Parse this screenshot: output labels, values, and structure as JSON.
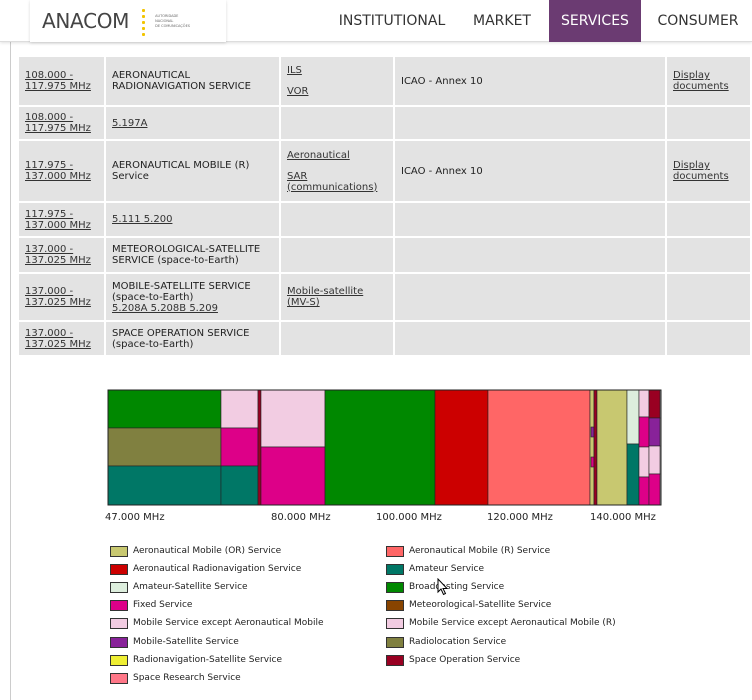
{
  "header": {
    "logo_text": "ANACOM",
    "logo_subtitle": [
      "AUTORIDADE",
      "NACIONAL",
      "DE COMUNICAÇÕES"
    ],
    "nav": [
      {
        "label": "INSTITUTIONAL",
        "active": false
      },
      {
        "label": "MARKET",
        "active": false
      },
      {
        "label": "SERVICES",
        "active": true
      },
      {
        "label": "CONSUMER",
        "active": false
      }
    ]
  },
  "table": {
    "rows": [
      {
        "band": "108.000 - 117.975 MHz",
        "service": "AERONAUTICAL RADIONAVIGATION SERVICE",
        "service_link": false,
        "applications": [
          "ILS",
          "VOR"
        ],
        "standard": "ICAO - Annex 10",
        "documents": "Display documents"
      },
      {
        "band": "108.000 - 117.975 MHz",
        "service": "5.197A",
        "service_link": true,
        "applications": [],
        "standard": "",
        "documents": ""
      },
      {
        "band": "117.975 - 137.000 MHz",
        "service": "AERONAUTICAL MOBILE (R) Service",
        "service_link": false,
        "applications": [
          "Aeronautical",
          "SAR (communications)"
        ],
        "standard": "ICAO - Annex 10",
        "documents": "Display documents"
      },
      {
        "band": "117.975 - 137.000 MHz",
        "service": "5.111 5.200",
        "service_link": true,
        "applications": [],
        "standard": "",
        "documents": ""
      },
      {
        "band": "137.000 - 137.025 MHz",
        "service": "METEOROLOGICAL-SATELLITE SERVICE (space-to-Earth)",
        "service_link": false,
        "applications": [],
        "standard": "",
        "documents": ""
      },
      {
        "band": "137.000 - 137.025 MHz",
        "service": "MOBILE-SATELLITE SERVICE (space-to-Earth)",
        "service_link": false,
        "service_footnote": "5.208A 5.208B 5.209",
        "applications": [
          "Mobile-satellite (MV-S)"
        ],
        "standard": "",
        "documents": ""
      },
      {
        "band": "137.000 - 137.025 MHz",
        "service": "SPACE OPERATION SERVICE (space-to-Earth)",
        "service_link": false,
        "applications": [],
        "standard": "",
        "documents": ""
      }
    ]
  },
  "colors": {
    "aero_mobile_or": "#c8c870",
    "aero_mobile_r": "#ff6666",
    "aero_radionav": "#cc0000",
    "amateur": "#007766",
    "amateur_sat": "#ddeedd",
    "broadcasting": "#008800",
    "fixed": "#dd0088",
    "meteo_sat": "#884400",
    "mobile_except_aero": "#f2cce2",
    "mobile_except_aero_r": "#f2cce2",
    "mobile_sat": "#882299",
    "radiolocation": "#808040",
    "radionav_sat": "#eeee33",
    "space_op": "#990022",
    "space_research": "#ff7788",
    "nav_active_bg": "#6b3b72"
  },
  "chart_data": {
    "type": "band-allocation",
    "x_ticks": [
      "47.000 MHz",
      "80.000 MHz",
      "100.000 MHz",
      "120.000 MHz",
      "140.000 MHz"
    ],
    "legend": [
      {
        "label": "Aeronautical Mobile (OR) Service",
        "color_key": "aero_mobile_or"
      },
      {
        "label": "Aeronautical Mobile (R) Service",
        "color_key": "aero_mobile_r"
      },
      {
        "label": "Aeronautical Radionavigation Service",
        "color_key": "aero_radionav"
      },
      {
        "label": "Amateur Service",
        "color_key": "amateur"
      },
      {
        "label": "Amateur-Satellite Service",
        "color_key": "amateur_sat"
      },
      {
        "label": "Broadcasting Service",
        "color_key": "broadcasting"
      },
      {
        "label": "Fixed Service",
        "color_key": "fixed"
      },
      {
        "label": "Meteorological-Satellite Service",
        "color_key": "meteo_sat"
      },
      {
        "label": "Mobile Service except Aeronautical Mobile",
        "color_key": "mobile_except_aero"
      },
      {
        "label": "Mobile Service except Aeronautical Mobile (R)",
        "color_key": "mobile_except_aero_r"
      },
      {
        "label": "Mobile-Satellite Service",
        "color_key": "mobile_sat"
      },
      {
        "label": "Radiolocation Service",
        "color_key": "radiolocation"
      },
      {
        "label": "Radionavigation-Satellite Service",
        "color_key": "radionav_sat"
      },
      {
        "label": "Space Operation Service",
        "color_key": "space_op"
      },
      {
        "label": "Space Research Service",
        "color_key": "space_research"
      }
    ]
  }
}
